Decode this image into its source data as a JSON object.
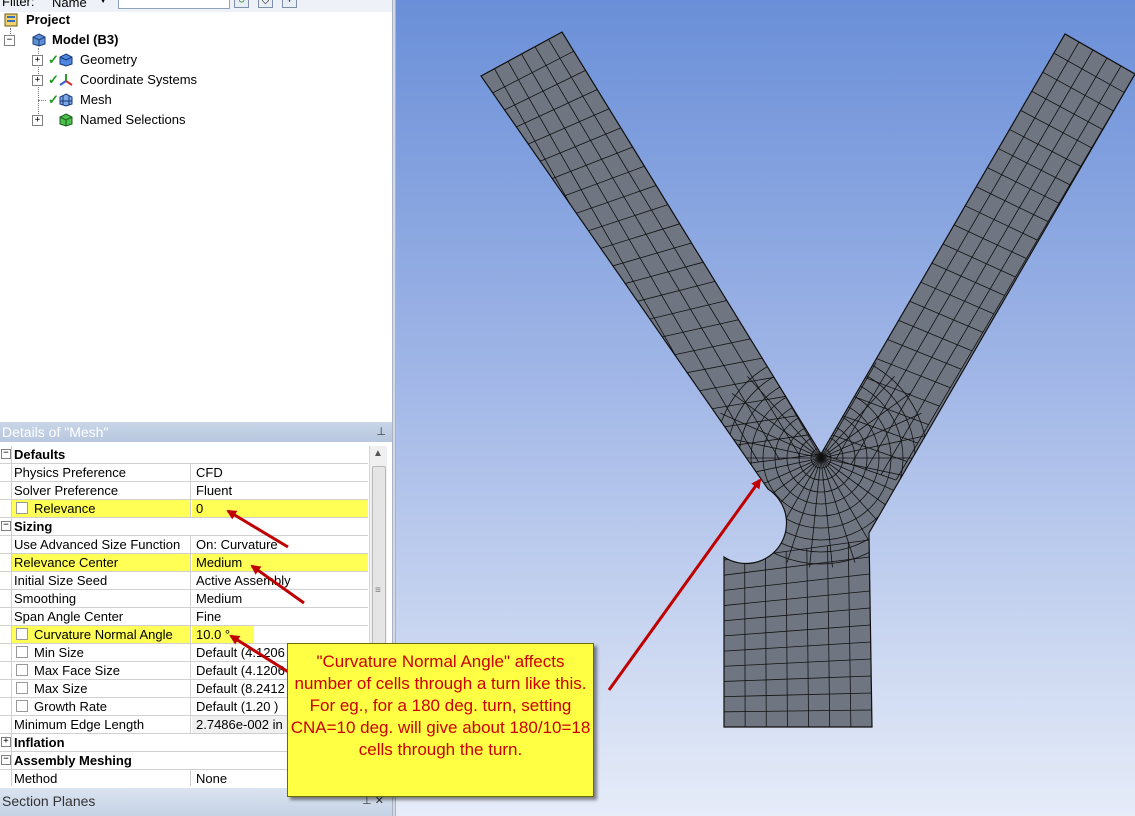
{
  "filter": {
    "label": "Filter:",
    "selected": "Name"
  },
  "tree": {
    "project": "Project",
    "model": "Model (B3)",
    "children": [
      "Geometry",
      "Coordinate Systems",
      "Mesh",
      "Named Selections"
    ]
  },
  "details": {
    "title": "Details of \"Mesh\"",
    "sections": {
      "defaults": "Defaults",
      "sizing": "Sizing",
      "inflation": "Inflation",
      "assembly": "Assembly Meshing"
    },
    "rows": {
      "physics": {
        "label": "Physics Preference",
        "value": "CFD"
      },
      "solver": {
        "label": "Solver Preference",
        "value": "Fluent"
      },
      "relevance": {
        "label": "Relevance",
        "value": "0"
      },
      "asf": {
        "label": "Use Advanced Size Function",
        "value": "On: Curvature"
      },
      "relcenter": {
        "label": "Relevance Center",
        "value": "Medium"
      },
      "seed": {
        "label": "Initial Size Seed",
        "value": "Active Assembly"
      },
      "smoothing": {
        "label": "Smoothing",
        "value": "Medium"
      },
      "span": {
        "label": "Span Angle Center",
        "value": "Fine"
      },
      "cna": {
        "label": "Curvature Normal Angle",
        "value": "10.0 °"
      },
      "minsize": {
        "label": "Min Size",
        "value": "Default (4.1206"
      },
      "maxface": {
        "label": "Max Face Size",
        "value": "Default (4.1206"
      },
      "maxsize": {
        "label": "Max Size",
        "value": "Default (8.2412"
      },
      "growth": {
        "label": "Growth Rate",
        "value": "Default (1.20 )"
      },
      "minedge": {
        "label": "Minimum Edge Length",
        "value": "2.7486e-002 in"
      },
      "method": {
        "label": "Method",
        "value": "None"
      }
    }
  },
  "section_planes": {
    "title": "Section Planes"
  },
  "callout": {
    "text": "\"Curvature Normal Angle\" affects number of cells through a turn like this. For eg., for a 180 deg. turn, setting CNA=10 deg. will give about 180/10=18 cells through the turn."
  },
  "colors": {
    "highlight": "#ffff55",
    "arrow": "#c00000",
    "callout_bg": "#ffff44",
    "callout_text": "#cc0000",
    "mesh_fill": "#6f7682",
    "mesh_lines": "#111111"
  },
  "icons": [
    "project-icon",
    "model-icon",
    "geometry-icon",
    "coordinate-systems-icon",
    "mesh-icon",
    "named-selections-icon"
  ]
}
